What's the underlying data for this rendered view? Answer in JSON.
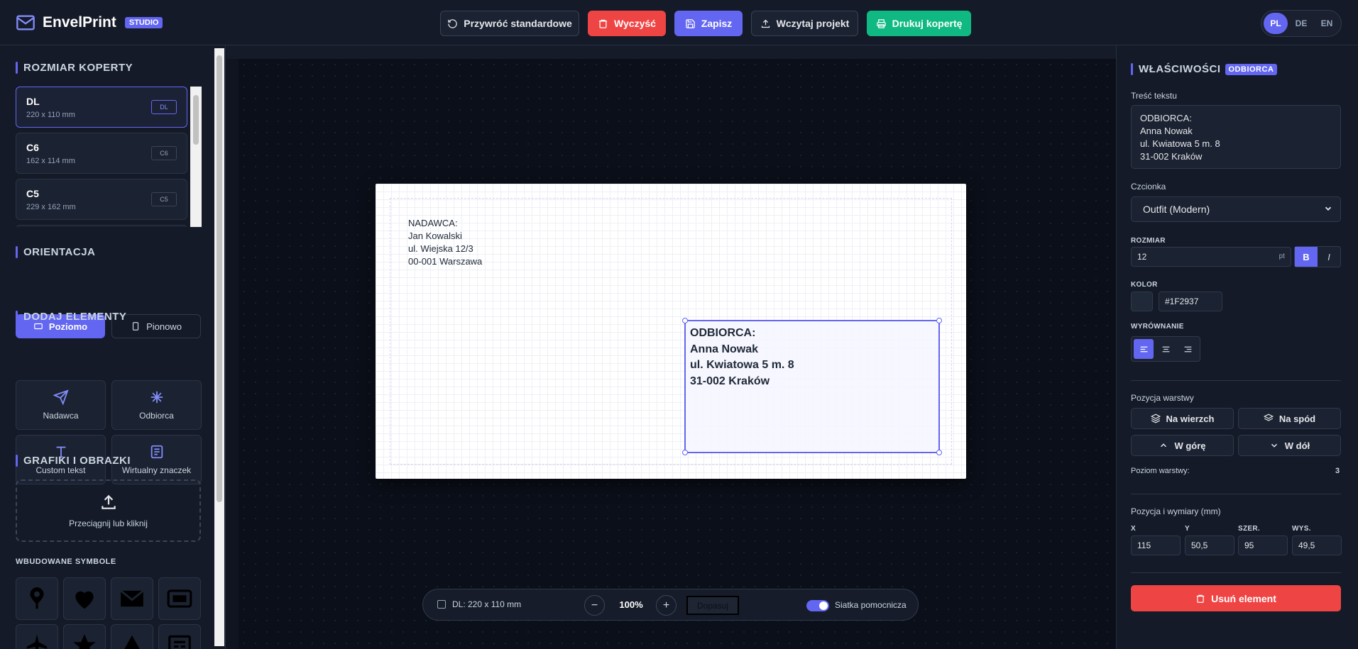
{
  "app": {
    "name": "EnvelPrint",
    "badge": "STUDIO"
  },
  "header_buttons": {
    "restore": "Przywróć standardowe",
    "clear": "Wyczyść",
    "save": "Zapisz",
    "load": "Wczytaj projekt",
    "print": "Drukuj kopertę"
  },
  "languages": [
    "PL",
    "DE",
    "EN"
  ],
  "active_language": "PL",
  "sidebar": {
    "size_title": "ROZMIAR KOPERTY",
    "sizes": [
      {
        "name": "DL",
        "dims": "220 x 110 mm",
        "tag": "DL"
      },
      {
        "name": "C6",
        "dims": "162 x 114 mm",
        "tag": "C6"
      },
      {
        "name": "C5",
        "dims": "229 x 162 mm",
        "tag": "C5"
      }
    ],
    "orientation_title": "ORIENTACJA",
    "orientation": {
      "landscape": "Poziomo",
      "portrait": "Pionowo"
    },
    "add_title": "DODAJ ELEMENTY",
    "add_items": {
      "sender": "Nadawca",
      "recipient": "Odbiorca",
      "custom": "Custom tekst",
      "stamp": "Wirtualny znaczek"
    },
    "graphics_title": "GRAFIKI I OBRAZKI",
    "upload_label": "Przeciągnij lub kliknij",
    "symbols_title": "WBUDOWANE SYMBOLE"
  },
  "envelope": {
    "sender_text": "NADAWCA:\nJan Kowalski\nul. Wiejska 12/3\n00-001 Warszawa",
    "recipient_text": "ODBIORCA:\nAnna Nowak\nul. Kwiatowa 5 m. 8\n31-002 Kraków"
  },
  "canvas_toolbar": {
    "size_label": "DL: 220 x 110 mm",
    "zoom": "100%",
    "fit": "Dopasuj",
    "grid_label": "Siatka pomocnicza",
    "grid_on": true
  },
  "properties": {
    "title": "WŁAŚCIWOŚCI",
    "badge": "ODBIORCA",
    "text_label": "Treść tekstu",
    "text_value": "ODBIORCA:\nAnna Nowak\nul. Kwiatowa 5 m. 8\n31-002 Kraków",
    "font_label": "Czcionka",
    "font_value": "Outfit (Modern)",
    "size_label": "ROZMIAR",
    "size_value": "12",
    "size_unit": "pt",
    "bold": "B",
    "italic": "I",
    "color_label": "KOLOR",
    "color_value": "#1F2937",
    "align_label": "WYRÓWNANIE",
    "layer_label": "Pozycja warstwy",
    "to_front": "Na wierzch",
    "to_back": "Na spód",
    "up": "W górę",
    "down": "W dół",
    "layer_level_label": "Poziom warstwy:",
    "layer_level": "3",
    "pos_label": "Pozycja i wymiary (mm)",
    "x_label": "X",
    "x": "115",
    "y_label": "Y",
    "y": "50,5",
    "w_label": "SZER.",
    "w": "95",
    "h_label": "WYS.",
    "h": "49,5",
    "delete": "Usuń element"
  },
  "colors": {
    "accent": "#6366f1",
    "danger": "#ef4444",
    "success": "#10b981",
    "text_color": "#1f2937"
  }
}
